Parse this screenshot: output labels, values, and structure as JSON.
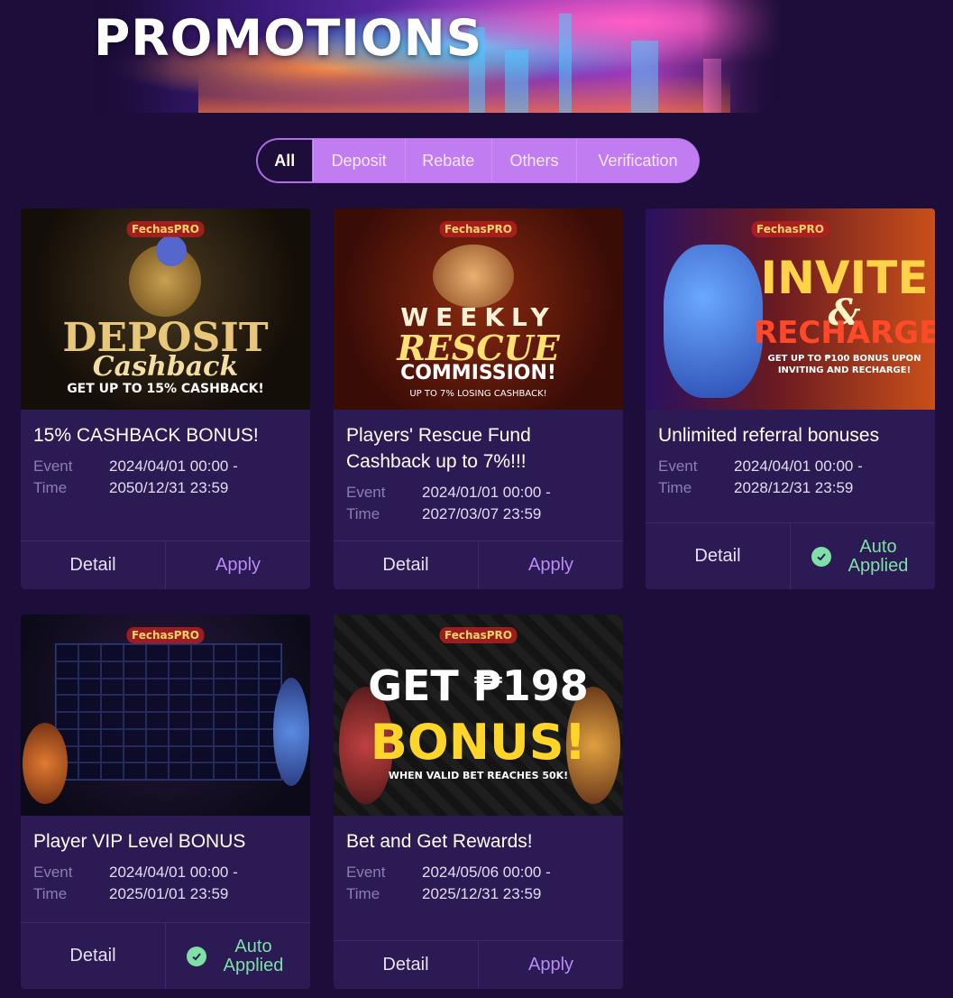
{
  "header": {
    "title": "PROMOTIONS"
  },
  "tabs": [
    {
      "label": "All",
      "active": true
    },
    {
      "label": "Deposit",
      "active": false
    },
    {
      "label": "Rebate",
      "active": false
    },
    {
      "label": "Others",
      "active": false
    },
    {
      "label": "Verification",
      "active": false
    }
  ],
  "labels": {
    "event": "Event",
    "time": "Time",
    "detail": "Detail",
    "apply": "Apply",
    "auto_line1": "Auto",
    "auto_line2": "Applied"
  },
  "colors": {
    "background": "#1c0d3a",
    "card": "#2c1a55",
    "tabs_accent": "#c07cf0",
    "apply_text": "#b88bf5",
    "auto_applied": "#7ee0a6"
  },
  "promotions": [
    {
      "title": "15% CASHBACK BONUS!",
      "start": "2024/04/01 00:00 -",
      "end": "2050/12/31 23:59",
      "status": "apply",
      "image": {
        "logo": "FechasPRO",
        "line1": "DEPOSIT",
        "line2": "Cashback",
        "line3": "GET UP TO 15% CASHBACK!"
      }
    },
    {
      "title": "Players' Rescue Fund Cashback up to 7%!!!",
      "start": "2024/01/01 00:00 -",
      "end": "2027/03/07 23:59",
      "status": "apply",
      "image": {
        "logo": "FechasPRO",
        "line1": "WEEKLY",
        "line2": "RESCUE",
        "line3": "COMMISSION!",
        "line4": "UP TO 7% LOSING CASHBACK!"
      }
    },
    {
      "title": "Unlimited referral bonuses",
      "start": "2024/04/01 00:00 -",
      "end": "2028/12/31 23:59",
      "status": "auto",
      "image": {
        "logo": "FechasPRO",
        "line1": "INVITE",
        "line2": "&",
        "line3": "RECHARGE",
        "line4": "GET UP TO ₱100 BONUS UPON INVITING AND RECHARGE!"
      }
    },
    {
      "title": "Player VIP Level BONUS",
      "start": "2024/04/01 00:00 -",
      "end": "2025/01/01 23:59",
      "status": "auto",
      "image": {
        "logo": "FechasPRO"
      }
    },
    {
      "title": "Bet and Get Rewards!",
      "start": "2024/05/06 00:00 -",
      "end": "2025/12/31 23:59",
      "status": "apply",
      "image": {
        "logo": "FechasPRO",
        "line1": "GET ₱198",
        "line2": "BONUS!",
        "line3": "WHEN VALID BET REACHES 50K!"
      }
    }
  ]
}
